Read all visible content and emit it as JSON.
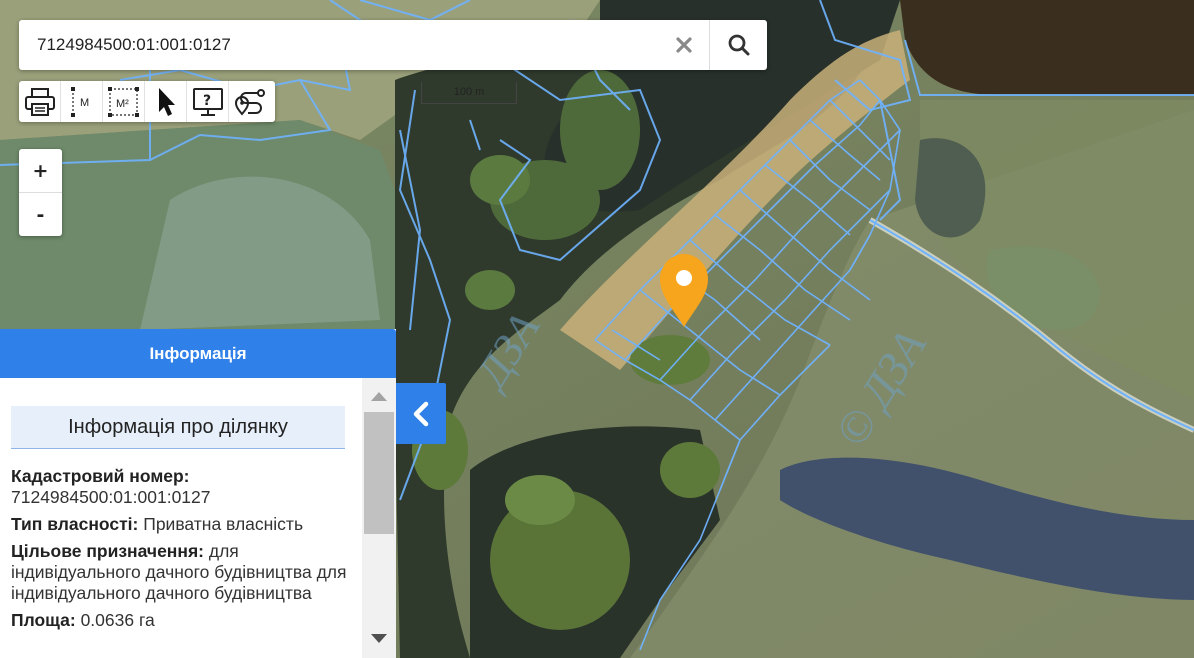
{
  "search": {
    "query": "7124984500:01:001:0127"
  },
  "toolbar": {
    "tools": [
      "print-icon",
      "measure-distance-icon",
      "measure-area-icon",
      "select-pointer-icon",
      "info-screen-icon",
      "route-icon"
    ],
    "measure_distance_label": "M",
    "measure_area_label": "M²"
  },
  "zoom": {
    "in_label": "+",
    "out_label": "-"
  },
  "scale": {
    "label": "100 m"
  },
  "map": {
    "watermark_left": "ДЗА",
    "watermark_right": "© ДЗА",
    "marker_color": "#f7a51c",
    "parcel_line_color": "#6fb3ff"
  },
  "panel": {
    "header": "Інформація",
    "section_title": "Інформація про ділянку",
    "fields": [
      {
        "label": "Кадастровий номер:",
        "value": "7124984500:01:001:0127",
        "block": true
      },
      {
        "label": "Тип власності:",
        "value": "Приватна власність",
        "block": false
      },
      {
        "label": "Цільове призначення:",
        "value": "для індивідуального дачного будівництва для індивідуального дачного будівництва",
        "block": false
      },
      {
        "label": "Площа:",
        "value": "0.0636 га",
        "block": false
      }
    ]
  },
  "colors": {
    "accent": "#2f80e8"
  }
}
